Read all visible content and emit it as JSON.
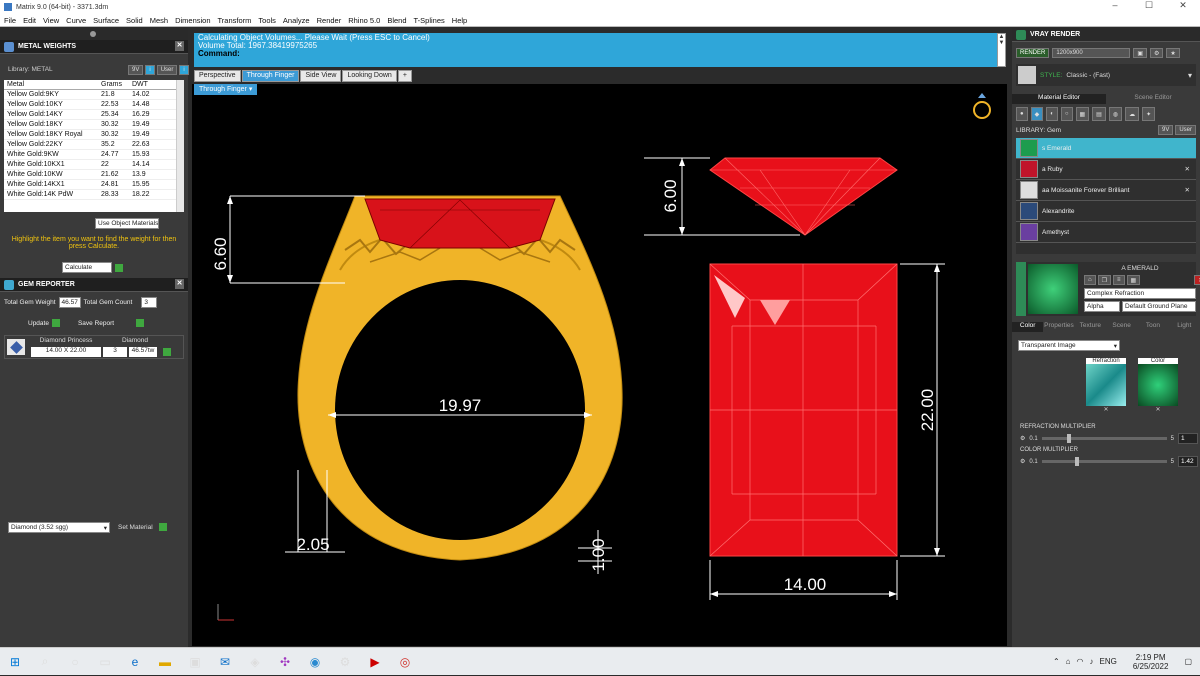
{
  "window": {
    "title": "Matrix 9.0 (64-bit) - 3371.3dm",
    "min": "–",
    "max": "☐",
    "close": "✕"
  },
  "menu": [
    "File",
    "Edit",
    "View",
    "Curve",
    "Surface",
    "Solid",
    "Mesh",
    "Dimension",
    "Transform",
    "Tools",
    "Analyze",
    "Render",
    "Rhino 5.0",
    "Blend",
    "T-Splines",
    "Help"
  ],
  "metal_weights": {
    "title": "METAL WEIGHTS",
    "library_label": "Library: METAL",
    "lib_9v": "9V",
    "lib_user": "User",
    "headers": [
      "Metal",
      "Grams",
      "DWT"
    ],
    "rows": [
      [
        "Yellow Gold:9KY",
        "21.8",
        "14.02"
      ],
      [
        "Yellow Gold:10KY",
        "22.53",
        "14.48"
      ],
      [
        "Yellow Gold:14KY",
        "25.34",
        "16.29"
      ],
      [
        "Yellow Gold:18KY",
        "30.32",
        "19.49"
      ],
      [
        "Yellow Gold:18KY Royal",
        "30.32",
        "19.49"
      ],
      [
        "Yellow Gold:22KY",
        "35.2",
        "22.63"
      ],
      [
        "White Gold:9KW",
        "24.77",
        "15.93"
      ],
      [
        "White Gold:10KX1",
        "22",
        "14.14"
      ],
      [
        "White Gold:10KW",
        "21.62",
        "13.9"
      ],
      [
        "White Gold:14KX1",
        "24.81",
        "15.95"
      ],
      [
        "White Gold:14K PdW",
        "28.33",
        "18.22"
      ]
    ],
    "use_object_materials": "Use Object Materials",
    "hint": "Highlight the item you want to find the weight for then press Calculate.",
    "calculate": "Calculate"
  },
  "gem_reporter": {
    "title": "GEM REPORTER",
    "total_weight_label": "Total Gem Weight",
    "total_weight": "46.57",
    "total_count_label": "Total Gem Count",
    "total_count": "3",
    "update": "Update",
    "save_report": "Save Report",
    "gem_type": "Diamond Princess",
    "gem_size": "14.00 X 22.00",
    "gem_material": "Diamond",
    "gem_count": "3",
    "gem_weight": "46.57tw",
    "material_select": "Diamond    (3.52 sgg)",
    "set_material": "Set Material"
  },
  "command": {
    "line1": "Calculating Object Volumes... Please Wait (Press ESC to Cancel)",
    "line2": "Volume Total: 1967.38419975265",
    "prompt": "Command:"
  },
  "viewport_tabs": [
    "Perspective",
    "Through Finger",
    "Side View",
    "Looking Down",
    "+"
  ],
  "active_view": "Through Finger",
  "dims": {
    "d660": "6.60",
    "d1997": "19.97",
    "d205": "2.05",
    "d100": "1.00",
    "d600": "6.00",
    "d2200": "22.00",
    "d1400": "14.00"
  },
  "vray": {
    "title": "VRAY RENDER",
    "render": "RENDER",
    "resolution": "1200x900",
    "style_label": "STYLE:",
    "style": "Classic - (Fast)",
    "material_editor": "Material Editor",
    "scene_editor": "Scene Editor",
    "library": "LIBRARY: Gem",
    "lib_9v": "9V",
    "lib_user": "User",
    "gems": [
      "s Emerald",
      "a Ruby",
      "aa Moissanite Forever Brilliant",
      "Alexandrite",
      "Amethyst"
    ],
    "selected_name": "A EMERALD",
    "complex_refraction": "Complex Refraction",
    "alpha": "Alpha",
    "ground_plane": "Default Ground Plane",
    "subtabs": [
      "Color",
      "Properties",
      "Texture",
      "Scene",
      "Toon",
      "Light"
    ],
    "transparent_image": "Transparent Image",
    "refraction_label": "Refraction",
    "color_label": "Color",
    "refraction_multiplier": "REFRACTION MULTIPLIER",
    "rm_min": "0.1",
    "rm_max": "5",
    "rm_value": "1",
    "color_multiplier": "COLOR MULTIPLIER",
    "cm_min": "0.1",
    "cm_max": "5",
    "cm_value": "1.42"
  },
  "taskbar": {
    "lang": "ENG",
    "time": "2:19 PM",
    "date": "6/25/2022"
  },
  "colors": {
    "accent": "#2fa6d9",
    "gold": "#f0b428",
    "ruby": "#e8101a"
  }
}
